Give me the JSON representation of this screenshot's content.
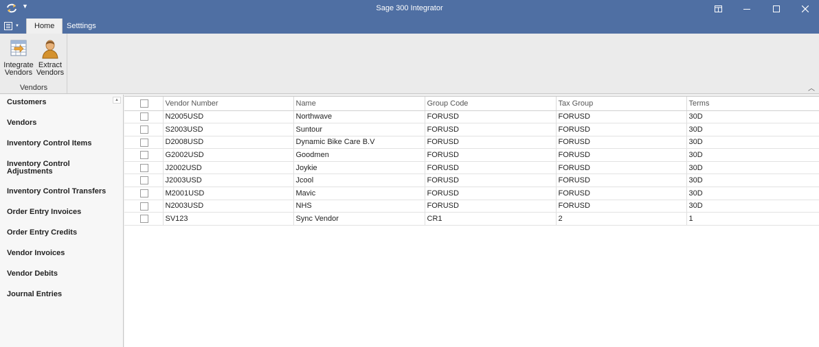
{
  "window": {
    "title": "Sage 300 Integrator"
  },
  "icons": {
    "app": "refresh-sync-icon",
    "quick_access": "dropdown-arrow-icon",
    "restore": "restore-window-icon",
    "minimize": "minimize-icon",
    "maximize": "maximize-icon",
    "close": "close-icon",
    "app_menu": "application-menu-icon",
    "collapse": "chevron-up-icon"
  },
  "tabs": [
    {
      "label": "Home"
    },
    {
      "label": "Setttings"
    }
  ],
  "ribbon": {
    "group_label": "Vendors",
    "buttons": [
      {
        "line1": "Integrate",
        "line2": "Vendors",
        "icon": "integrate-table-icon"
      },
      {
        "line1": "Extract",
        "line2": "Vendors",
        "icon": "person-icon"
      }
    ]
  },
  "sidebar": {
    "items": [
      {
        "label": "Customers"
      },
      {
        "label": "Vendors"
      },
      {
        "label": "Inventory Control Items"
      },
      {
        "label": "Inventory Control Adjustments"
      },
      {
        "label": "Inventory Control Transfers"
      },
      {
        "label": "Order Entry Invoices"
      },
      {
        "label": "Order Entry Credits"
      },
      {
        "label": "Vendor Invoices"
      },
      {
        "label": "Vendor Debits"
      },
      {
        "label": "Journal Entries"
      }
    ]
  },
  "grid": {
    "columns": [
      "Vendor Number",
      "Name",
      "Group Code",
      "Tax Group",
      "Terms"
    ],
    "rows": [
      [
        "N2005USD",
        "Northwave",
        "FORUSD",
        "FORUSD",
        "30D"
      ],
      [
        "S2003USD",
        "Suntour",
        "FORUSD",
        "FORUSD",
        "30D"
      ],
      [
        "D2008USD",
        "Dynamic Bike Care B.V",
        "FORUSD",
        "FORUSD",
        "30D"
      ],
      [
        "G2002USD",
        "Goodmen",
        "FORUSD",
        "FORUSD",
        "30D"
      ],
      [
        "J2002USD",
        "Joykie",
        "FORUSD",
        "FORUSD",
        "30D"
      ],
      [
        "J2003USD",
        "Jcool",
        "FORUSD",
        "FORUSD",
        "30D"
      ],
      [
        "M2001USD",
        "Mavic",
        "FORUSD",
        "FORUSD",
        "30D"
      ],
      [
        "N2003USD",
        "NHS",
        "FORUSD",
        "FORUSD",
        "30D"
      ],
      [
        "SV123",
        "Sync Vendor",
        "CR1",
        "2",
        "1"
      ]
    ]
  }
}
